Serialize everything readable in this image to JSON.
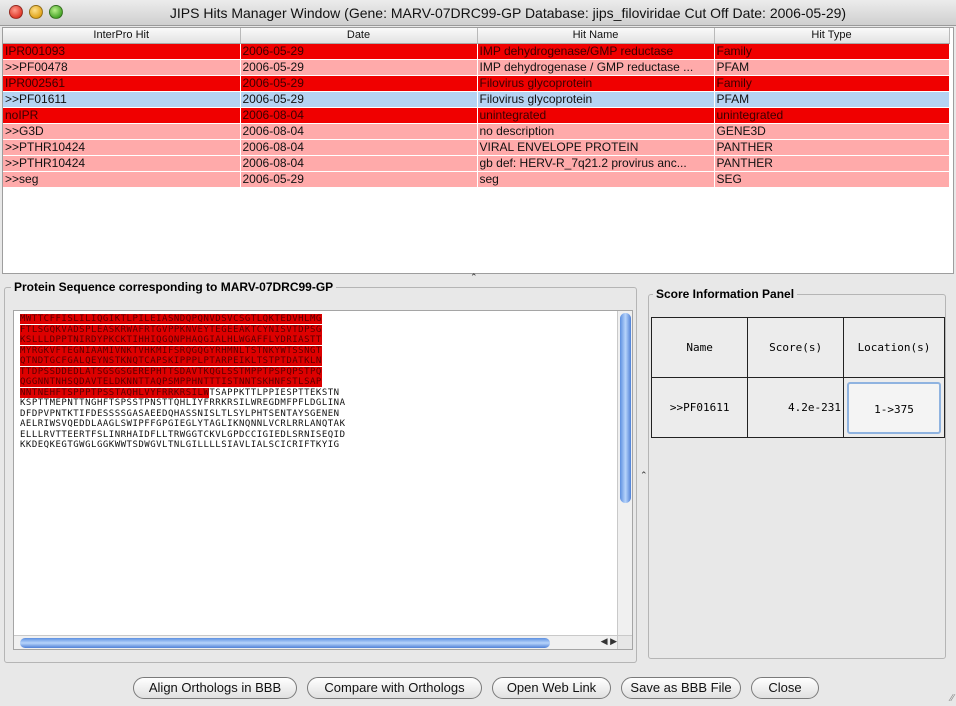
{
  "window": {
    "title": "JIPS Hits Manager Window (Gene: MARV-07DRC99-GP Database: jips_filoviridae Cut Off Date: 2006-05-29)"
  },
  "hits_table": {
    "columns": [
      "InterPro Hit",
      "Date",
      "Hit Name",
      "Hit Type"
    ],
    "rows": [
      {
        "hit": "IPR001093",
        "date": "2006-05-29",
        "name": "IMP dehydrogenase/GMP reductase",
        "type": "Family",
        "kind": "ipr"
      },
      {
        "hit": ">>PF00478",
        "date": "2006-05-29",
        "name": "IMP dehydrogenase / GMP reductase ...",
        "type": "PFAM",
        "kind": "child"
      },
      {
        "hit": "IPR002561",
        "date": "2006-05-29",
        "name": "Filovirus glycoprotein",
        "type": "Family",
        "kind": "ipr"
      },
      {
        "hit": ">>PF01611",
        "date": "2006-05-29",
        "name": "Filovirus glycoprotein",
        "type": "PFAM",
        "kind": "selected"
      },
      {
        "hit": "noIPR",
        "date": "2006-08-04",
        "name": "unintegrated",
        "type": "unintegrated",
        "kind": "ipr"
      },
      {
        "hit": ">>G3D",
        "date": "2006-08-04",
        "name": "no description",
        "type": "GENE3D",
        "kind": "child"
      },
      {
        "hit": ">>PTHR10424",
        "date": "2006-08-04",
        "name": "VIRAL ENVELOPE PROTEIN",
        "type": "PANTHER",
        "kind": "child"
      },
      {
        "hit": ">>PTHR10424",
        "date": "2006-08-04",
        "name": "gb def: HERV-R_7q21.2 provirus anc...",
        "type": "PANTHER",
        "kind": "child"
      },
      {
        "hit": ">>seg",
        "date": "2006-05-29",
        "name": "seg",
        "type": "SEG",
        "kind": "child"
      }
    ]
  },
  "sequence_panel": {
    "title": "Protein Sequence corresponding to MARV-07DRC99-GP",
    "highlight_lines": [
      "MWTTCFFISLILIQGIKTLPILEIASNDQPQNVDSVCSGTLQKTEDVHLMGFTLSGQKVADSPLEASKRWAFRTGVPPKNVEYTEGEEAKTCYNISVTDPSGKSLLLDPPTNIRDYPKCKTIHHIQGQNPHAQGIALHLWGAFFLYDRIASTTMYRGKVFTEGNIAAMIVNKTVHKMIFSRQGQGYRHMNLTSTNKYWTSSNGTQTNDTGCFGALQEYNSTKNQTCAPSKIPPPLPTARPEIKLTSTPTDATKLNTTDPSSDDEDLATSGSGSGEREPHTTSDAVTKQGLSSTMPPTPSPQPSTPQQGGNNTNHSQDAVTELDKNNTTAQPSMPPHNTTTISTNNTSKHNFSTLSAPLQNTTNDNTQSTITENEQTSAPSITTLPPTGNPTTAKSTSSKKGPATTAPNTTNEHFTSPPPTPSSTAQHLVYFRRKRSILWREGDMFPFLDGLINAPIDFDPVPNTKTIFDESSSSGASAEEDQHASPNISLTLSYFPNINENTAYSGENENDCDAELRIWSVQEDDLAAGLSWIPFFGPGIEGLYTAGLIKNQNNLVCRLRRLANQTAKSLELLLRVTTEERTFSLINRHAIDFLLTRWGGTCKVLGPDCCIGIEDLSRNISEQIDQIKKDEQKEGTGWGLGGKWWTSDWGVLTNLGILLLLSIAVLIALSCICRIFTKYIG"
    ],
    "lines": [
      "MWTTCFFISLILIQGIKTLPILEIASNDQPQNVDSVCSGTLQKTEDVHLMG",
      "FTLSGQKVADSPLEASKRWAFRTGVPPKNVEYTEGEEAKTCYNISVTDPSG",
      "KSLLLDPPTNIRDYPKCKTIHHIQGQNPHAQGIALHLWGAFFLYDRIASTT",
      "MYRGKVFTEGNIAAMIVNKTVHKMIFSRQGQGYRHMNLTSTNKYWTSSNGT",
      "QTNDTGCFGALQEYNSTKNQTCAPSKIPPPLPTARPEIKLTSTPTDATKLN",
      "TTDPSSDDEDLATSGSGSGEREPHTTSDAVTKQGLSSTMPPTPSPQPSTPQ",
      "QGGNNTNHSQDAVTELDKNNTTAQPSMPPHNTTTISTNNTSKHNFSTLSAP",
      "NNTNEHFTSPPPTPSSTAQHLVYFRRKRSILWREGDMFPFLDGLINAPIDE",
      "KSPTTMEPNTTNGHFTSPSSTPNSTTQHLIYFRRKRSILWREGDMFPFLDGLINA",
      "DFDPVPNTKTIFDESSSSGASAEEDQHASSNISLTLSYLPHTSENTAYSGENEN",
      "AELRIWSVQEDDLAAGLSWIPFFGPGIEGLYTAGLIKNQNNLVCRLRRLANQTAK",
      "ELLLRVTTEERTFSLINRHAIDFLLTRWGGTCKVLGPDCCIGIEDLSRNISEQID",
      "KKDEQKEGTGWGLGGKWWTSDWGVLTNLGILLLLSIAVLIALSCICRIFTKYIG"
    ],
    "highlighted_line_count": 7,
    "partial_highlight_line": {
      "index": 7,
      "highlighted": "NNTNEHFTSPPPTPSSTAQHLVYFRRKRSILW",
      "rest": "TSAPPKTTLPPIESPTTEKSTN"
    }
  },
  "score_panel": {
    "title": "Score Information Panel",
    "headers": [
      "Name",
      "Score(s)",
      "Location(s)"
    ],
    "row": {
      "name": ">>PF01611",
      "score": "4.2e-231",
      "location": "1->375"
    }
  },
  "buttons": {
    "align": "Align Orthologs in BBB",
    "compare": "Compare with Orthologs",
    "open": "Open Web Link",
    "save": "Save as BBB File",
    "close": "Close"
  },
  "colors": {
    "ipr_row": "#f00000",
    "child_row": "#ffaaaa",
    "selected_row": "#b5d3f2",
    "sequence_highlight": "#dd0000"
  },
  "icons": [
    "close-window-icon",
    "minimize-window-icon",
    "zoom-window-icon",
    "split-up-arrow-icon",
    "split-left-arrow-icon",
    "scroll-left-arrow-icon",
    "scroll-right-arrow-icon",
    "resize-grip-icon"
  ]
}
